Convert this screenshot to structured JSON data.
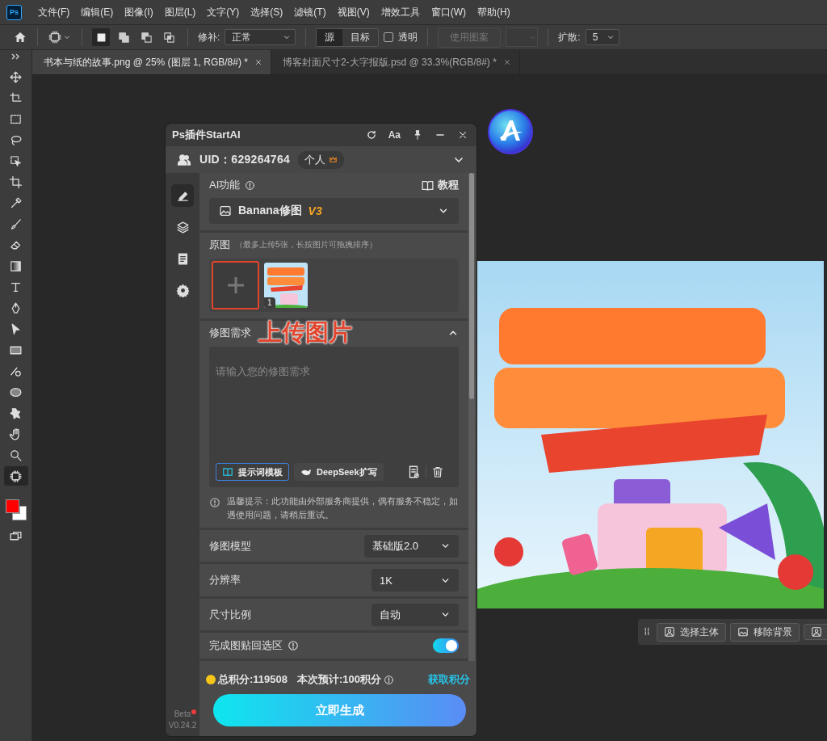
{
  "app_logo": "Ps",
  "menu_bar": {
    "items": [
      "文件(F)",
      "编辑(E)",
      "图像(I)",
      "图层(L)",
      "文字(Y)",
      "选择(S)",
      "滤镜(T)",
      "视图(V)",
      "增效工具",
      "窗口(W)",
      "帮助(H)"
    ]
  },
  "options_bar": {
    "shape_modes": [
      {
        "kind": "new",
        "selected": true
      },
      {
        "kind": "add",
        "selected": false
      },
      {
        "kind": "subtract",
        "selected": false
      },
      {
        "kind": "intersect",
        "selected": false
      }
    ],
    "patch": {
      "label": "修补:",
      "value": "正常"
    },
    "source_target": [
      {
        "label": "源",
        "selected": true
      },
      {
        "label": "目标",
        "selected": false
      }
    ],
    "transparent": {
      "label": "透明",
      "checked": false
    },
    "pattern_button": {
      "label": "使用图案",
      "disabled": true
    },
    "diffusion": {
      "label": "扩散:",
      "value": "5"
    }
  },
  "document_tabs": [
    {
      "title": "书本与纸的故事.png @ 25% (图层 1, RGB/8#) *",
      "selected": true
    },
    {
      "title": "博客封面尺寸2-大字报版.psd @ 33.3%(RGB/8#) *",
      "selected": false
    }
  ],
  "tools": [
    {
      "kind": "move",
      "selected": false
    },
    {
      "kind": "artboard",
      "selected": false
    },
    {
      "kind": "marquee",
      "selected": false
    },
    {
      "kind": "lasso",
      "selected": false
    },
    {
      "kind": "object-select",
      "selected": false
    },
    {
      "kind": "crop",
      "selected": false
    },
    {
      "kind": "eyedropper",
      "selected": false
    },
    {
      "kind": "brush",
      "selected": false
    },
    {
      "kind": "eraser",
      "selected": false
    },
    {
      "kind": "gradient",
      "selected": false
    },
    {
      "kind": "type",
      "selected": false
    },
    {
      "kind": "pen",
      "selected": false
    },
    {
      "kind": "path-select",
      "selected": false
    },
    {
      "kind": "rectangle",
      "selected": false
    },
    {
      "kind": "brush-circle",
      "selected": false
    },
    {
      "kind": "ellipse",
      "selected": false
    },
    {
      "kind": "puzzle",
      "selected": false
    },
    {
      "kind": "hand",
      "selected": false
    },
    {
      "kind": "zoom",
      "selected": false
    },
    {
      "kind": "patch",
      "selected": true
    }
  ],
  "colors": [
    {
      "kind": "foreground",
      "color": "#ff0000"
    },
    {
      "kind": "background",
      "color": "#ffffff"
    }
  ],
  "plugin": {
    "title": "Ps插件StartAI",
    "font_button": "Aa",
    "user": {
      "uid": "UID：629264764",
      "plan": "个人"
    },
    "nav": [
      {
        "kind": "edit",
        "selected": true
      },
      {
        "kind": "layers",
        "selected": false
      },
      {
        "kind": "document",
        "selected": false
      },
      {
        "kind": "settings",
        "selected": false
      }
    ],
    "feature": {
      "label": "AI功能",
      "tutorial": "教程",
      "model": "Banana修图",
      "version": "V3"
    },
    "source": {
      "title": "原图",
      "hint": "（最多上传5张，长按图片可拖拽排序）",
      "images": [
        {
          "index": "1",
          "kind": "picture"
        }
      ]
    },
    "request": {
      "title": "修图需求",
      "expanded": true,
      "placeholder": "请输入您的修图需求",
      "buttons": [
        {
          "label": "提示词模板",
          "selected": true
        },
        {
          "label": "DeepSeek扩写",
          "selected": false
        }
      ],
      "notice": "温馨提示：此功能由外部服务商提供，偶有服务不稳定，如遇使用问题，请稍后重试。"
    },
    "settings": [
      {
        "kind": "select",
        "label": "修图模型",
        "value": "基础版2.0"
      },
      {
        "kind": "select",
        "label": "分辨率",
        "value": "1K"
      },
      {
        "kind": "select",
        "label": "尺寸比例",
        "value": "自动"
      },
      {
        "kind": "toggle",
        "label": "完成图贴回选区",
        "on": true
      }
    ],
    "points": {
      "total": "总积分:119508",
      "estimate": "本次预计:100积分",
      "link": "获取积分"
    },
    "generate_button": "立即生成",
    "beta": "Beta",
    "version": "V0.24.2"
  },
  "annotation": {
    "text": "上传图片"
  },
  "task_bar": {
    "buttons": [
      "选择主体",
      "移除背景"
    ]
  }
}
